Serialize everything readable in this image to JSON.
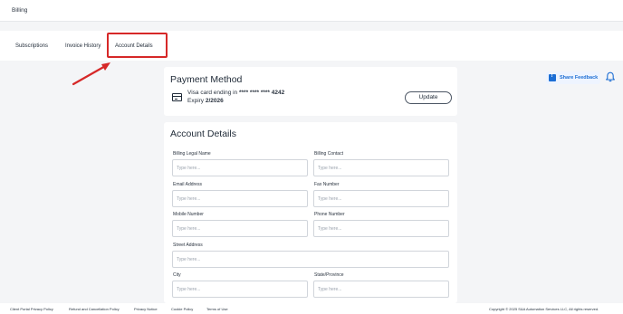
{
  "header": {
    "title": "Billing"
  },
  "tabs": [
    {
      "label": "Subscriptions"
    },
    {
      "label": "Invoice History"
    },
    {
      "label": "Account Details"
    }
  ],
  "toolbar": {
    "feedback_label": "Share Feedback"
  },
  "payment": {
    "title": "Payment Method",
    "card_prefix": "Visa card ending in",
    "card_number": "**** **** **** 4242",
    "expiry_label": "Expiry",
    "expiry_value": "2/2026",
    "update_label": "Update"
  },
  "account": {
    "title": "Account Details",
    "fields": {
      "billing_legal_name": {
        "label": "Billing Legal Name",
        "placeholder": "Type here..."
      },
      "billing_contact": {
        "label": "Billing Contact",
        "placeholder": "Type here..."
      },
      "email_address": {
        "label": "Email Address",
        "placeholder": "Type here..."
      },
      "fax_number": {
        "label": "Fax Number",
        "placeholder": "Type here..."
      },
      "mobile_number": {
        "label": "Mobile Number",
        "placeholder": "Type here..."
      },
      "phone_number": {
        "label": "Phone Number",
        "placeholder": "Type here..."
      },
      "street_address": {
        "label": "Street Address",
        "placeholder": "Type here..."
      },
      "city": {
        "label": "City",
        "placeholder": "Type here..."
      },
      "state_province": {
        "label": "State/Province",
        "placeholder": "Type here..."
      }
    }
  },
  "footer": {
    "links": [
      "Client Portal Privacy Policy",
      "Refund and Cancellation Policy",
      "Privacy Notice",
      "Cookie Policy",
      "Terms of Use"
    ],
    "copyright": "Copyright © 2025 S&A Automation Services LLC, All rights reserved."
  },
  "icons": {
    "feedback": "feedback-icon",
    "bell": "bell-icon",
    "credit_card": "credit-card-icon",
    "annotation_arrow": "arrow-icon"
  },
  "colors": {
    "accent": "#1c6ed4",
    "highlight": "#d62828"
  }
}
